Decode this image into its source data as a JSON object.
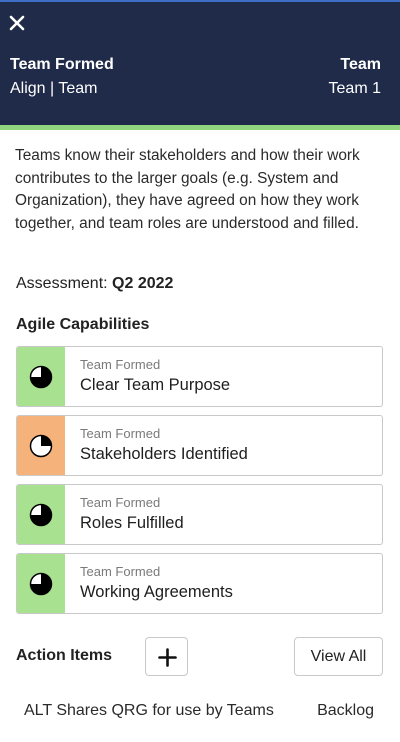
{
  "header": {
    "close_icon": "close-icon",
    "left_title": "Team Formed",
    "left_subtitle": "Align | Team",
    "right_title": "Team",
    "right_subtitle": "Team 1",
    "bg_color": "#1f2b49",
    "accent_color": "#8fd67f"
  },
  "description": "Teams know their stakeholders and how their work contributes to the larger goals (e.g. System and Organization), they have agreed on how they work together, and team roles are understood and filled.",
  "assessment": {
    "label": "Assessment:",
    "value": "Q2 2022"
  },
  "capabilities": {
    "title": "Agile Capabilities",
    "items": [
      {
        "eyebrow": "Team Formed",
        "name": "Clear Team Purpose",
        "status_color": "#a8e18f",
        "progress": 0.75,
        "icon": "pie-progress-icon"
      },
      {
        "eyebrow": "Team Formed",
        "name": "Stakeholders Identified",
        "status_color": "#f5b27a",
        "progress": 0.25,
        "icon": "pie-progress-icon"
      },
      {
        "eyebrow": "Team Formed",
        "name": "Roles Fulfilled",
        "status_color": "#a8e18f",
        "progress": 0.75,
        "icon": "pie-progress-icon"
      },
      {
        "eyebrow": "Team Formed",
        "name": "Working Agreements",
        "status_color": "#a8e18f",
        "progress": 0.75,
        "icon": "pie-progress-icon"
      }
    ]
  },
  "action_items": {
    "title": "Action Items",
    "add_icon": "plus-icon",
    "view_all_label": "View All",
    "items": [
      {
        "text": "ALT Shares QRG for use by Teams",
        "status": "Backlog"
      }
    ]
  }
}
